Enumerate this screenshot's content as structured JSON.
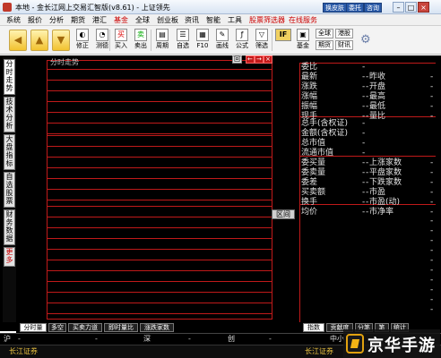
{
  "window": {
    "title": "本地 - 金长江网上交易汇智版(v8.61) - 上证领先",
    "title_buttons": [
      "换皮肤",
      "委托",
      "咨询"
    ]
  },
  "menu": [
    "系统",
    "报价",
    "分析",
    "期货",
    "港汇",
    "基金",
    "全球",
    "创业板",
    "资讯",
    "智能",
    "工具",
    "股票筛选器",
    "在线服务"
  ],
  "toolbar": {
    "buttons": [
      "修正",
      "测德",
      "买入",
      "卖出",
      "周期",
      "自选",
      "F10",
      "画线",
      "公式",
      "筛选",
      "基金"
    ],
    "right_buttons": [
      "全球",
      "港股",
      "期货",
      "财讯"
    ]
  },
  "left_tabs": [
    "分时走势",
    "技术分析",
    "大盘指标",
    "自选股票",
    "财务数据",
    "更多"
  ],
  "chart": {
    "label": "分时走势",
    "controls": [
      "回",
      "←",
      "→",
      "×"
    ],
    "section_label": "区间"
  },
  "panel": {
    "rows": [
      {
        "l": "委比",
        "lv": "-"
      },
      {
        "l": "最新",
        "lv": "-",
        "r": "昨收",
        "rv": "-"
      },
      {
        "l": "涨跌",
        "lv": "-",
        "r": "开盘",
        "rv": "-"
      },
      {
        "l": "涨幅",
        "lv": "-",
        "r": "最高",
        "rv": "-"
      },
      {
        "l": "振幅",
        "lv": "-",
        "r": "最低",
        "rv": "-"
      },
      {
        "l": "现手",
        "lv": "-",
        "r": "量比",
        "rv": "-"
      },
      {
        "l": "总手(含权证)",
        "lv": "-"
      },
      {
        "l": "金额(含权证)",
        "lv": "-"
      },
      {
        "l": "总市值",
        "lv": "-"
      },
      {
        "l": "流通市值",
        "lv": "-"
      },
      {
        "l": "委买量",
        "lv": "-",
        "r": "上涨家数",
        "rv": "-"
      },
      {
        "l": "委卖量",
        "lv": "-",
        "r": "平盘家数",
        "rv": "-"
      },
      {
        "l": "委差",
        "lv": "-",
        "r": "下跌家数",
        "rv": "-"
      },
      {
        "l": "买卖额",
        "lv": "-",
        "r": "市盈",
        "rv": "-"
      },
      {
        "l": "换手",
        "lv": "-",
        "r": "市盈(动)",
        "rv": "-"
      },
      {
        "l": "均价",
        "lv": "-",
        "r": "市净率",
        "rv": "-"
      }
    ]
  },
  "bottom_tabs": [
    "分时量",
    "多空",
    "买卖力道",
    "即时量比",
    "涨跌家数",
    "指数",
    "贡献度",
    "分笔",
    "笔",
    "统计"
  ],
  "status": {
    "markets": [
      "沪",
      "深",
      "创",
      "中小"
    ],
    "broker": "长江证券"
  },
  "watermark": {
    "text": "京华手游"
  }
}
